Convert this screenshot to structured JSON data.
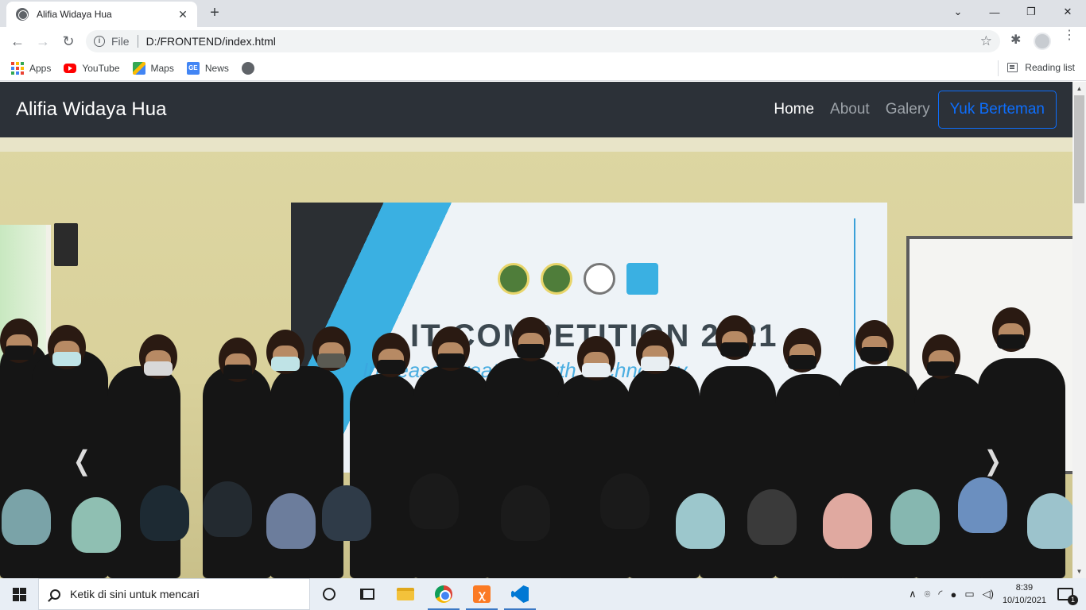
{
  "browser": {
    "tab_title": "Alifia Widaya Hua",
    "tab_close": "✕",
    "new_tab": "+",
    "window_controls": {
      "dropdown": "⌄",
      "minimize": "—",
      "restore": "❐",
      "close": "✕"
    },
    "nav": {
      "back": "←",
      "forward": "→",
      "reload": "↻"
    },
    "address": {
      "scheme_label": "File",
      "url": "D:/FRONTEND/index.html",
      "info": "i"
    },
    "star": "☆",
    "extensions": "✱",
    "menu": "⋮",
    "bookmarks": [
      {
        "label": "Apps",
        "icon": "apps-grid-icon"
      },
      {
        "label": "YouTube",
        "icon": "youtube-icon"
      },
      {
        "label": "Maps",
        "icon": "maps-icon"
      },
      {
        "label": "News",
        "icon": "news-icon"
      },
      {
        "label": "",
        "icon": "globe-icon"
      }
    ],
    "reading_list": "Reading list"
  },
  "site": {
    "brand": "Alifia Widaya Hua",
    "nav": [
      {
        "label": "Home",
        "state": "active"
      },
      {
        "label": "About",
        "state": "inactive"
      },
      {
        "label": "Galery",
        "state": "inactive"
      }
    ],
    "cta": "Yuk Berteman",
    "carousel": {
      "prev": "❮",
      "next": "❯",
      "banner_headline": "IT COMPETITION 2021",
      "banner_subline": "Increase Creativity with Technology"
    }
  },
  "colors": {
    "navbar_bg": "#2c3138",
    "cta_accent": "#0d6efd",
    "nav_muted": "#9da3a9"
  },
  "taskbar": {
    "search_placeholder": "Ketik di sini untuk mencari",
    "pinned": [
      "cortana-icon",
      "task-view-icon",
      "file-explorer-icon",
      "chrome-icon",
      "xampp-icon",
      "vscode-icon"
    ],
    "tray": {
      "chevron": "∧",
      "time": "8:39",
      "date": "10/10/2021",
      "notifications": "1"
    }
  }
}
